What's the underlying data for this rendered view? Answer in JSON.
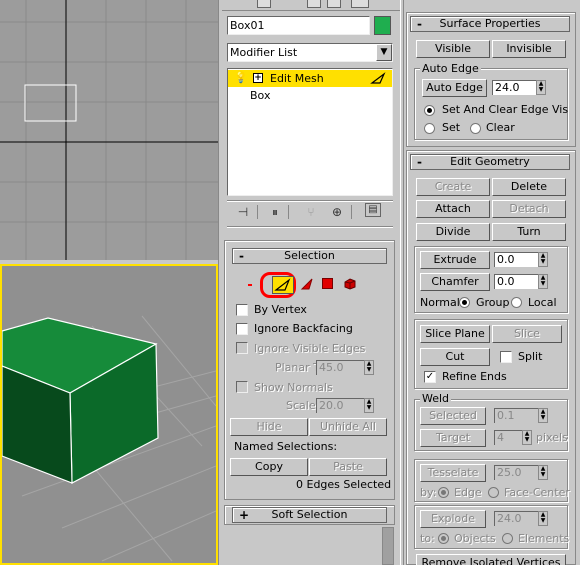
{
  "object": {
    "name": "Box01",
    "color": "#1fae4f"
  },
  "modifier_list": {
    "label": "Modifier List"
  },
  "stack": {
    "items": [
      {
        "label": "Edit Mesh",
        "highlighted": true,
        "expand": "+",
        "has_bulb": true
      },
      {
        "label": "Box",
        "highlighted": false
      }
    ]
  },
  "selection": {
    "title": "Selection",
    "by_vertex": "By Vertex",
    "ignore_backfacing": "Ignore Backfacing",
    "ignore_visible_edges": "Ignore Visible Edges",
    "planar_thresh_label": "Planar Thresh:",
    "planar_thresh_value": "45.0",
    "show_normals": "Show Normals",
    "scale_label": "Scale:",
    "scale_value": "20.0",
    "hide": "Hide",
    "unhide_all": "Unhide All",
    "named_selections": "Named Selections:",
    "copy": "Copy",
    "paste": "Paste",
    "status": "0 Edges Selected",
    "active_level": "edge"
  },
  "soft_selection": {
    "title": "Soft Selection",
    "sign": "+"
  },
  "surface_properties": {
    "title": "Surface Properties",
    "sign": "-",
    "visible": "Visible",
    "invisible": "Invisible",
    "auto_edge_group": "Auto Edge",
    "auto_edge_button": "Auto Edge",
    "auto_edge_value": "24.0",
    "opt_set_and_clear": "Set And Clear Edge Vis",
    "opt_set": "Set",
    "opt_clear": "Clear"
  },
  "edit_geometry": {
    "title": "Edit Geometry",
    "sign": "-",
    "create": "Create",
    "delete": "Delete",
    "attach": "Attach",
    "detach": "Detach",
    "divide": "Divide",
    "turn": "Turn",
    "extrude": "Extrude",
    "extrude_value": "0.0",
    "chamfer": "Chamfer",
    "chamfer_value": "0.0",
    "normal_label": "Normal:",
    "normal_group": "Group",
    "normal_local": "Local",
    "slice_plane": "Slice Plane",
    "slice": "Slice",
    "cut": "Cut",
    "split": "Split",
    "refine_ends": "Refine Ends",
    "weld_group": "Weld",
    "selected": "Selected",
    "selected_value": "0.1",
    "target": "Target",
    "target_value": "4",
    "pixels": "pixels",
    "tessellate": "Tesselate",
    "tessellate_value": "25.0",
    "by_label": "by:",
    "by_edge": "Edge",
    "by_face_center": "Face-Center",
    "explode": "Explode",
    "explode_value": "24.0",
    "to_label": "to:",
    "to_objects": "Objects",
    "to_elements": "Elements",
    "remove_isolated": "Remove Isolated Vertices"
  },
  "colors": {
    "highlight": "#ffe000",
    "annotation": "#ff0000",
    "box_green": "#1e8a3c"
  }
}
